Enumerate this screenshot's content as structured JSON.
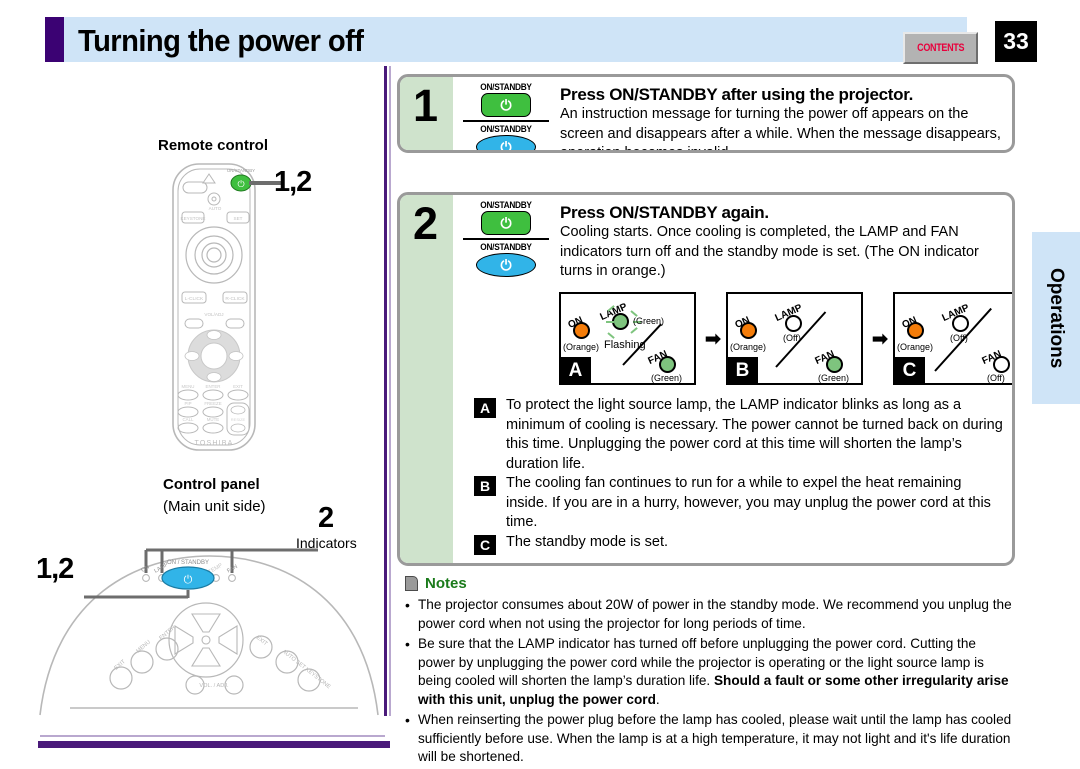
{
  "header": {
    "title": "Turning the power off",
    "contents_label": "CONTENTS",
    "page_number": "33"
  },
  "side_tab": {
    "label": "Operations"
  },
  "left_column": {
    "remote_title": "Remote control",
    "remote_callout": "1,2",
    "remote_brand": "TOSHIBA",
    "control_panel_title": "Control panel",
    "control_panel_subtitle": "(Main unit side)",
    "control_panel_callout": "1,2",
    "indicators_callout": "2",
    "indicators_label": "Indicators",
    "remote_buttons": [
      "INPUT",
      "LASER",
      "ON/STANDBY",
      "KEYSTONE",
      "AUTO",
      "SET",
      "L-CLICK",
      "R-CLICK",
      "VOL/ADJ",
      "MENU",
      "ENTER",
      "EXIT",
      "PIP",
      "FREEZE",
      "CALL",
      "MUTE",
      "RESIZE"
    ],
    "panel_buttons": [
      "INPUT",
      "MENU",
      "ENTER",
      "ON / STANDBY",
      "EXIT",
      "AUTO SET",
      "KEYSTONE",
      "VOL. / ADJ."
    ],
    "panel_indicator_labels": [
      "ON",
      "LAMP",
      "TEMP",
      "FAN"
    ]
  },
  "steps": [
    {
      "number": "1",
      "button_caption_top": "ON/STANDBY",
      "button_caption_bottom": "ON/STANDBY",
      "power_glyph": "⏻",
      "heading": "Press ON/STANDBY after using the projector.",
      "body": "An instruction message for turning the power off appears on the screen and disappears after a while. When the message disappears, operation becomes invalid."
    },
    {
      "number": "2",
      "button_caption_top": "ON/STANDBY",
      "button_caption_bottom": "ON/STANDBY",
      "power_glyph": "⏻",
      "heading": "Press ON/STANDBY again.",
      "body": "Cooling starts. Once cooling is completed, the LAMP and FAN indicators turn off and the standby mode is set. (The ON indicator turns in orange.)"
    }
  ],
  "diagrams": [
    {
      "letter": "A",
      "on": {
        "name": "ON",
        "state": "(Orange)",
        "color": "#f57d0a"
      },
      "lamp": {
        "name": "LAMP",
        "state": "(Green)",
        "color": "#7ec47e",
        "extra": "Flashing"
      },
      "fan": {
        "name": "FAN",
        "state": "(Green)",
        "color": "#7ec47e"
      }
    },
    {
      "letter": "B",
      "on": {
        "name": "ON",
        "state": "(Orange)",
        "color": "#f57d0a"
      },
      "lamp": {
        "name": "LAMP",
        "state": "(Off)",
        "color": "#ffffff",
        "extra": ""
      },
      "fan": {
        "name": "FAN",
        "state": "(Green)",
        "color": "#7ec47e"
      }
    },
    {
      "letter": "C",
      "on": {
        "name": "ON",
        "state": "(Orange)",
        "color": "#f57d0a"
      },
      "lamp": {
        "name": "LAMP",
        "state": "(Off)",
        "color": "#ffffff",
        "extra": ""
      },
      "fan": {
        "name": "FAN",
        "state": "(Off)",
        "color": "#ffffff"
      }
    }
  ],
  "arrow_glyph": "➡",
  "abc_notes": [
    {
      "badge": "A",
      "text": "To protect the light source lamp, the LAMP indicator blinks as long as a minimum of cooling is necessary. The power cannot be turned back on during this time. Unplugging the power cord at this time will shorten the lamp’s duration life."
    },
    {
      "badge": "B",
      "text": "The cooling fan continues to run for a while to expel the heat remaining inside. If you are in a hurry, however, you may unplug the power cord at this time."
    },
    {
      "badge": "C",
      "text": "The standby mode is set."
    }
  ],
  "notes": {
    "title": "Notes",
    "bullet": "•",
    "items": [
      {
        "pre": "The projector consumes about 20W of power in the standby mode. We recommend you unplug the power cord when not using the projector for long periods of time.",
        "bold": "",
        "post": ""
      },
      {
        "pre": "Be sure that the LAMP indicator has turned off before unplugging the power cord. Cutting the power by unplugging the power cord while the projector is operating or the light source lamp is being cooled will shorten the lamp’s duration life. ",
        "bold": "Should a fault or some other irregularity arise with this unit, unplug the power cord",
        "post": "."
      },
      {
        "pre": "When reinserting the power plug before the lamp has cooled, please wait until the lamp has cooled sufficiently before use. When the lamp is at a high temperature, it may not light and it's life duration will be shortened.",
        "bold": "",
        "post": ""
      }
    ]
  },
  "colors": {
    "header_band": "#cfe4f7",
    "accent_purple": "#3b0273",
    "green_band": "#cfe3cc",
    "power_green": "#3fbf3f",
    "power_blue": "#31b4e8",
    "contents_red": "#e8003c",
    "notes_green": "#1a7a1a"
  }
}
